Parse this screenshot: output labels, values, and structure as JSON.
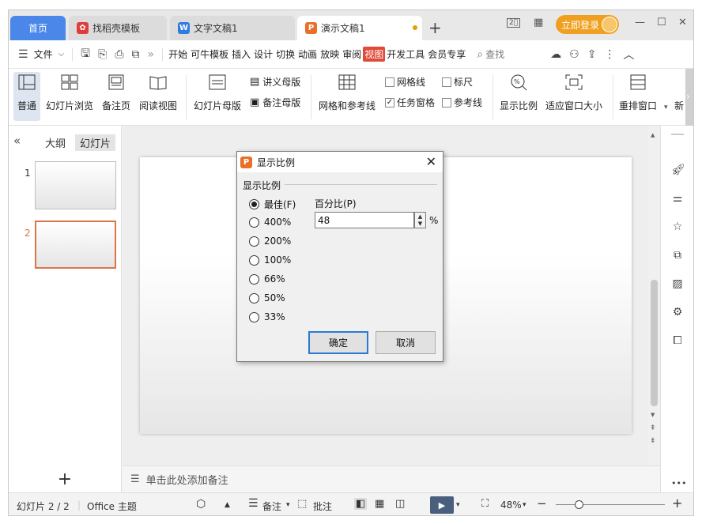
{
  "tabs": {
    "home": "首页",
    "t1": "找稻壳模板",
    "t2": "文字文稿1",
    "t3": "演示文稿1",
    "new": "+"
  },
  "title_bar": {
    "login": "立即登录"
  },
  "menu": {
    "file": "文件",
    "items": [
      "开始",
      "可牛模板",
      "插入",
      "设计",
      "切换",
      "动画",
      "放映",
      "审阅",
      "视图",
      "开发工具",
      "会员专享"
    ],
    "active": "视图",
    "search": "查找"
  },
  "ribbon": {
    "normal": "普通",
    "sorter": "幻灯片浏览",
    "notes_page": "备注页",
    "reading": "阅读视图",
    "slide_master": "幻灯片母版",
    "handout_master": "讲义母版",
    "notes_master": "备注母版",
    "grid_guides": "网格和参考线",
    "gridlines": "网格线",
    "ruler": "标尺",
    "task_pane": "任务窗格",
    "guides": "参考线",
    "zoom": "显示比例",
    "fit": "适应窗口大小",
    "arrange": "重排窗口",
    "new_win": "新"
  },
  "left_panel": {
    "outline": "大纲",
    "slides": "幻灯片",
    "numbers": [
      "1",
      "2"
    ]
  },
  "notes": {
    "placeholder": "单击此处添加备注"
  },
  "status": {
    "slide": "幻灯片 2 / 2",
    "theme": "Office 主题",
    "notes": "备注",
    "comments": "批注",
    "zoom": "48%"
  },
  "dialog": {
    "title": "显示比例",
    "group": "显示比例",
    "options": [
      "最佳(F)",
      "400%",
      "200%",
      "100%",
      "66%",
      "50%",
      "33%"
    ],
    "selected": "最佳(F)",
    "percent_label": "百分比(P)",
    "percent_value": "48",
    "percent_unit": "%",
    "ok": "确定",
    "cancel": "取消"
  },
  "colors": {
    "accent": "#4a87e8",
    "active_tab": "#e04a3a",
    "login": "#f0a020",
    "selection": "#d9764a"
  }
}
